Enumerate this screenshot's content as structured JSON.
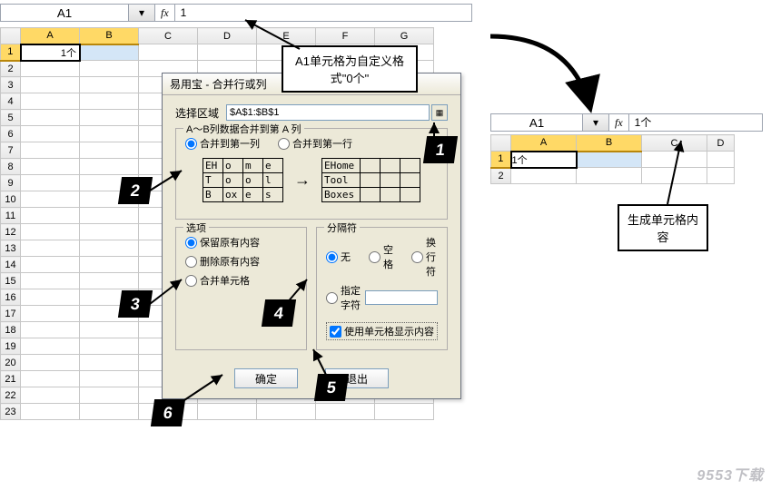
{
  "left_bar": {
    "name": "A1",
    "fx": "fx",
    "value": "1"
  },
  "right_bar": {
    "name": "A1",
    "fx": "fx",
    "value": "1个"
  },
  "left_sheet": {
    "cols": [
      "A",
      "B",
      "C",
      "D",
      "E",
      "F",
      "G"
    ],
    "rows": [
      1,
      2,
      3,
      4,
      5,
      6,
      7,
      8,
      9,
      10,
      11,
      12,
      13,
      14,
      15,
      16,
      17,
      18,
      19,
      20,
      21,
      22,
      23
    ],
    "a1": "1个"
  },
  "right_sheet": {
    "cols": [
      "A",
      "B",
      "C",
      "D"
    ],
    "rows": [
      1,
      2
    ],
    "a1": "1个"
  },
  "dialog": {
    "title": "易用宝 - 合并行或列",
    "range_label": "选择区域",
    "range_value": "$A$1:$B$1",
    "group1_title": "A～B列数据合并到第 A 列",
    "merge_col": "合并到第一列",
    "merge_row": "合并到第一行",
    "example_left": [
      [
        "EH",
        "o",
        "m",
        "e"
      ],
      [
        "T",
        "o",
        "o",
        "l"
      ],
      [
        "B",
        "ox",
        "e",
        "s"
      ]
    ],
    "example_right": [
      [
        "EHome"
      ],
      [
        "Tool"
      ],
      [
        "Boxes"
      ]
    ],
    "opt_title": "选项",
    "opt_keep": "保留原有内容",
    "opt_delete": "删除原有内容",
    "opt_merge_cells": "合并单元格",
    "delim_title": "分隔符",
    "delim_none": "无",
    "delim_space": "空格",
    "delim_newline": "换行符",
    "delim_char": "指定字符",
    "use_cell_display": "使用单元格显示内容",
    "ok": "确定",
    "exit": "退出"
  },
  "callouts": {
    "a1_format": "A1单元格为自定义格式\"0个\"",
    "gen_content": "生成单元格内容"
  },
  "badges": {
    "b1": "1",
    "b2": "2",
    "b3": "3",
    "b4": "4",
    "b5": "5",
    "b6": "6"
  },
  "watermark": "9553下载"
}
